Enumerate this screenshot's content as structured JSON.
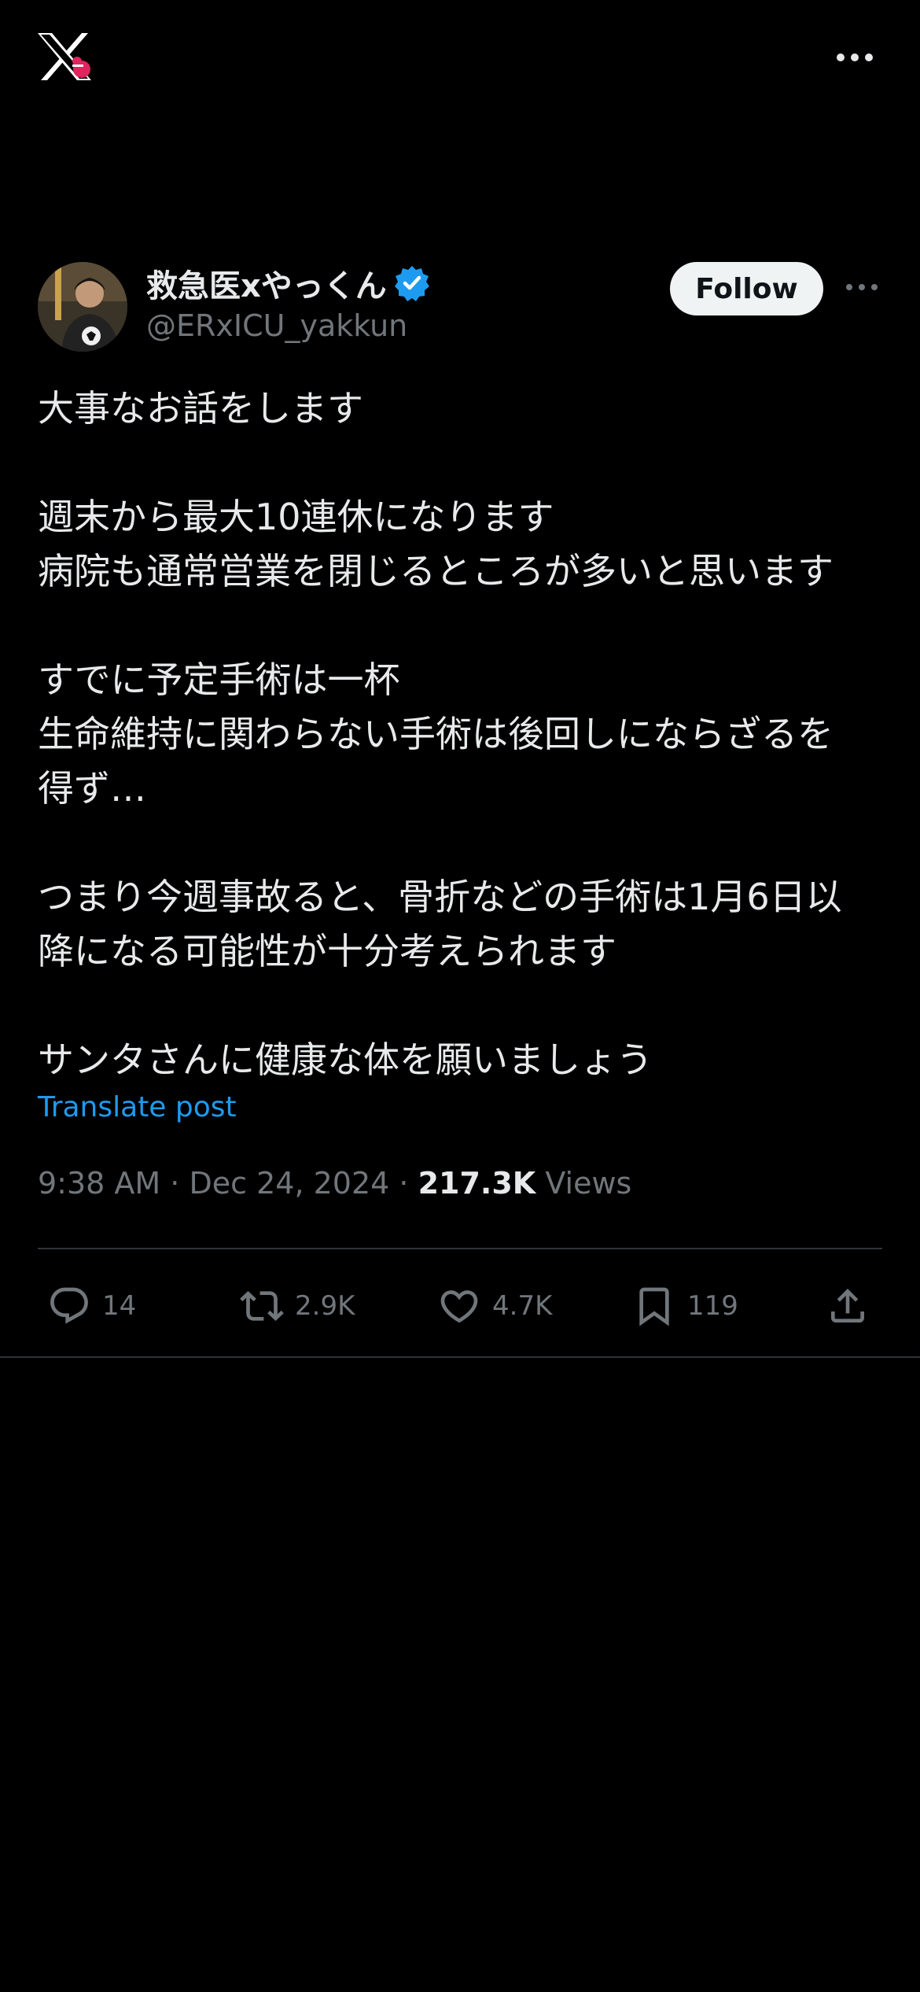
{
  "header": {
    "logo_icon": "x-logo-icon",
    "more_icon": "more-horizontal-icon"
  },
  "post": {
    "author": {
      "display_name": "救急医xやっくん",
      "handle": "@ERxICU_yakkun",
      "verified": true,
      "verified_color": "#1d9bf0"
    },
    "follow_label": "Follow",
    "text_lines": [
      "大事なお話をします",
      "",
      "週末から最大10連休になります",
      "病院も通常営業を閉じるところが多いと思います",
      "",
      "すでに予定手術は一杯",
      "生命維持に関わらない手術は後回しにならざるを",
      "得ず…",
      "",
      "つまり今週事故ると、骨折などの手術は1月6日以",
      "降になる可能性が十分考えられます",
      "",
      "サンタさんに健康な体を願いましょう"
    ],
    "translate_label": "Translate post",
    "time": "9:38 AM",
    "date": "Dec 24, 2024",
    "separator": "·",
    "views_count": "217.3K",
    "views_label": "Views",
    "stats": {
      "replies": "14",
      "reposts": "2.9K",
      "likes": "4.7K",
      "bookmarks": "119"
    }
  },
  "colors": {
    "background": "#000000",
    "text": "#e7e9ea",
    "muted": "#71767b",
    "link": "#1d9bf0",
    "border": "#2f3336"
  }
}
